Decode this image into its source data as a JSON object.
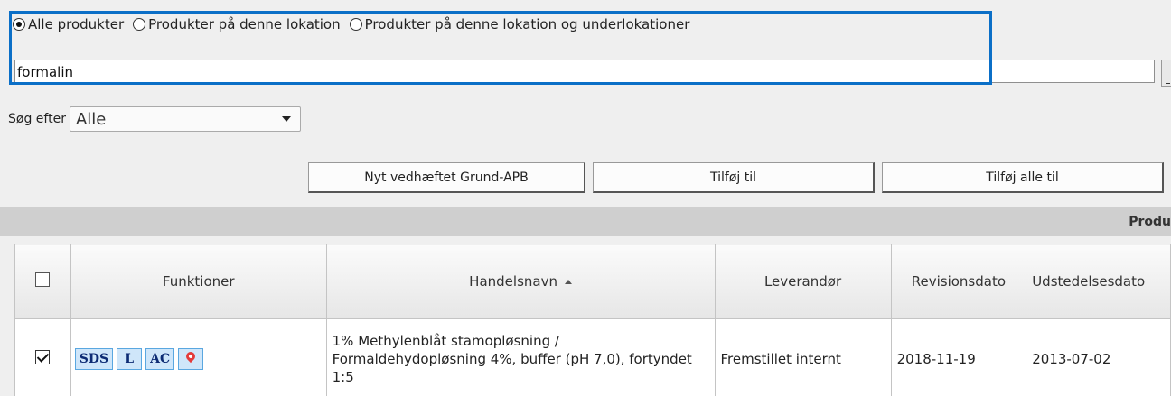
{
  "filter": {
    "options": [
      "Alle produkter",
      "Produkter på denne lokation",
      "Produkter på denne lokation og underlokationer"
    ],
    "selected_index": 0
  },
  "search": {
    "value": "formalin"
  },
  "search_for": {
    "label": "Søg efter",
    "selected": "Alle"
  },
  "toolbar": {
    "new_button": "Nyt vedhæftet Grund-APB",
    "add_button": "Tilføj til",
    "add_all_button": "Tilføj alle til"
  },
  "section": {
    "title": "Produ"
  },
  "table": {
    "headers": {
      "functions": "Funktioner",
      "trade_name": "Handelsnavn",
      "supplier": "Leverandør",
      "revision_date": "Revisionsdato",
      "issue_date": "Udstedelsesdato"
    },
    "rows": [
      {
        "checked": true,
        "functions": [
          "SDS",
          "L",
          "AC"
        ],
        "trade_name": "1% Methylenblåt stamopløsning / Formaldehydopløsning 4%, buffer (pH 7,0), fortyndet 1:5",
        "supplier": "Fremstillet internt",
        "revision_date": "2018-11-19",
        "issue_date": "2013-07-02"
      }
    ]
  },
  "colors": {
    "highlight": "#0b6fc7",
    "function_button_bg": "#cfe6fa",
    "section_bar": "#cfcfcf"
  }
}
